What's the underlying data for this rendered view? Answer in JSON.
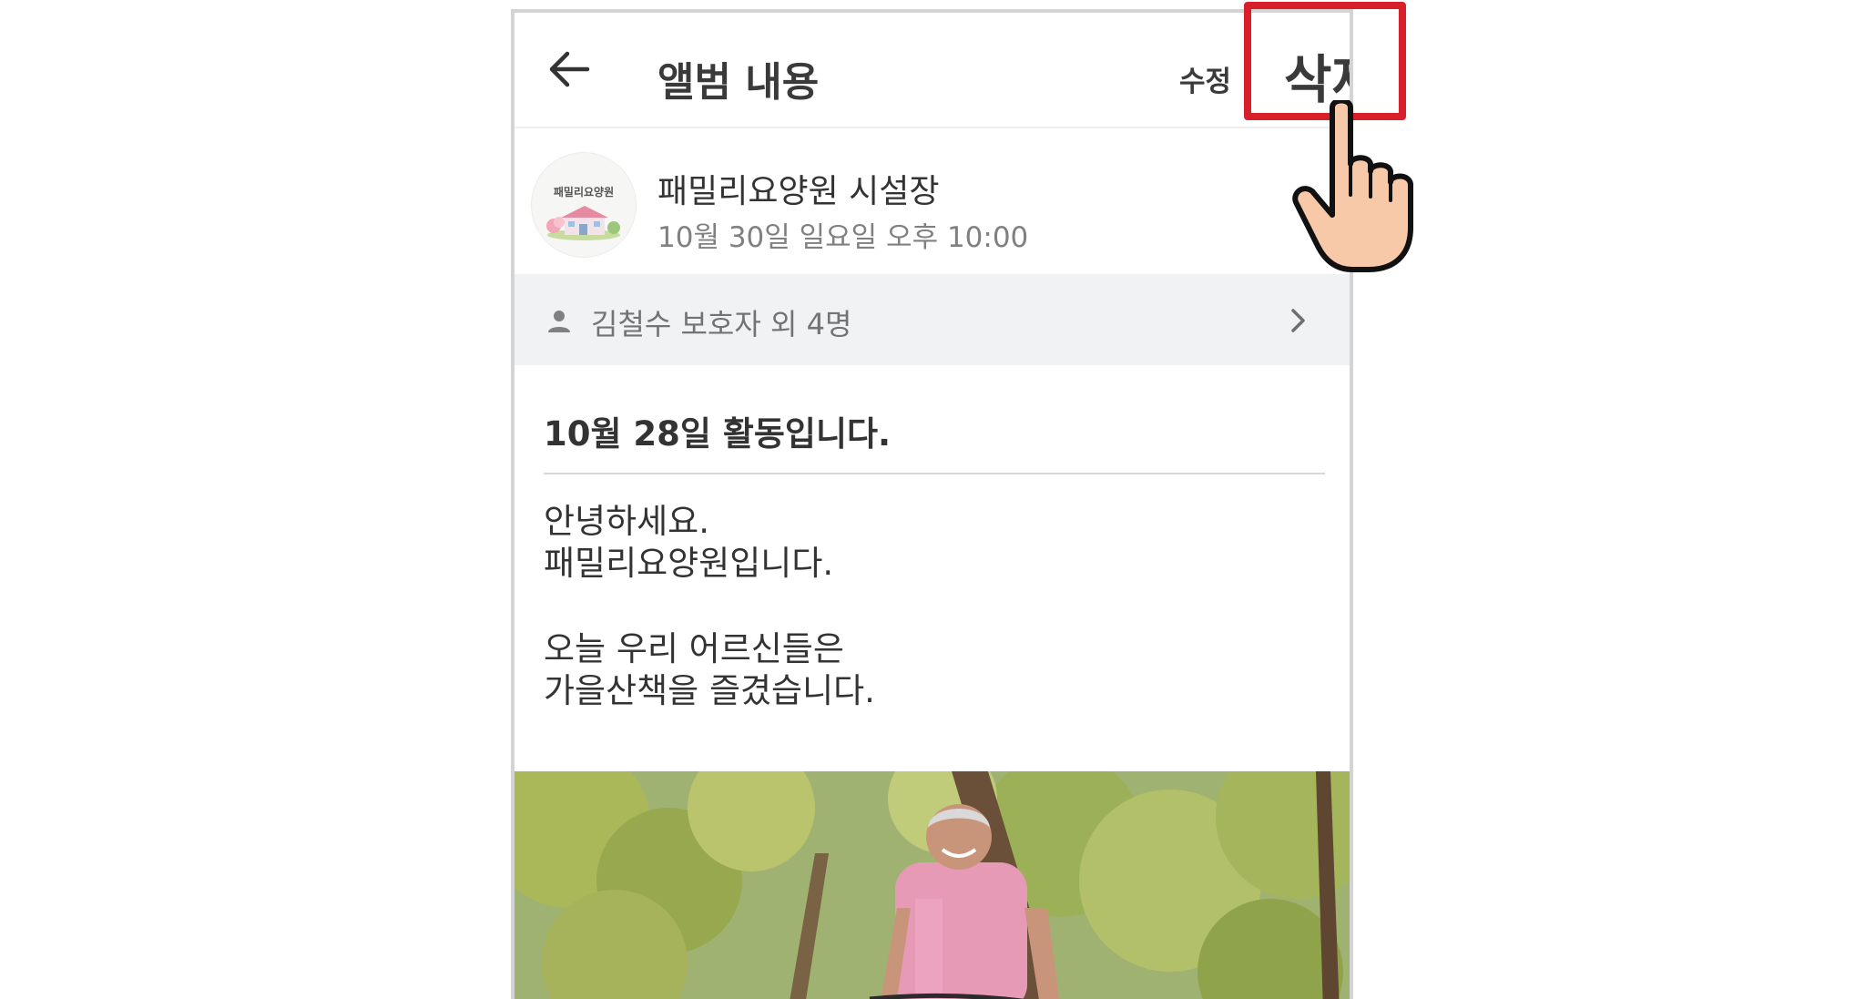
{
  "appbar": {
    "title": "앨범 내용",
    "edit_label": "수정",
    "delete_label": "삭제"
  },
  "author": {
    "avatar_text": "패밀리요양원",
    "name": "패밀리요양원 시설장",
    "date": "10월 30일 일요일 오후 10:00"
  },
  "recipients": {
    "text": "김철수 보호자 외 4명"
  },
  "post": {
    "title": "10월 28일 활동입니다.",
    "body_lines": [
      "안녕하세요.",
      "패밀리요양원입니다.",
      "오늘 우리 어르신들은",
      "가을산책을 즐겼습니다."
    ]
  },
  "colors": {
    "highlight": "#d7202a",
    "recipients_bg": "#f0f2f4",
    "text": "#333333",
    "muted": "#808080",
    "hand_skin": "#f7c9a8"
  },
  "icons": [
    "back-arrow-icon",
    "person-icon",
    "chevron-right-icon",
    "pointing-hand-icon"
  ]
}
